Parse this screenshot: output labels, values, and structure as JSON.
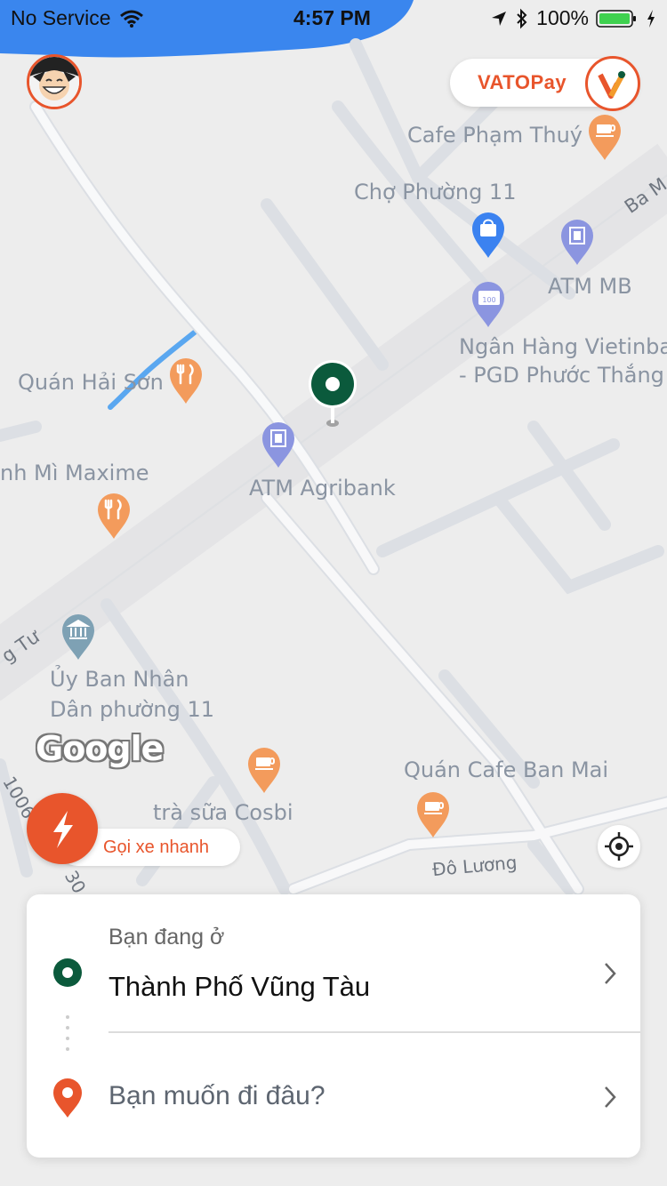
{
  "status_bar": {
    "carrier": "No Service",
    "time": "4:57 PM",
    "battery": "100%"
  },
  "vatopay": {
    "label": "VATOPay"
  },
  "map": {
    "labels": [
      "Cafe Phạm Thuý",
      "Chợ Phường 11",
      "ATM MB",
      "Ngân Hàng Vietinba",
      "- PGD Phước Thắng",
      "Quán Hải Sơn",
      "nh Mì Maxime",
      "ATM Agribank",
      "Ủy Ban Nhân",
      "Dân phường 11",
      "Quán Cafe Ban Mai",
      "trà sữa Cosbi",
      "Đô Lương",
      "Ba M",
      "g Tư",
      "1006",
      "30"
    ],
    "attribution": "Google"
  },
  "quick_ride": {
    "label": "Gọi xe nhanh"
  },
  "card": {
    "current_caption": "Bạn đang ở",
    "current_value": "Thành Phố Vũng Tàu",
    "destination_placeholder": "Bạn muốn đi đâu?"
  },
  "icons": [
    "avatar",
    "vatopay-logo-icon",
    "pickup-pin-icon",
    "lightning-icon",
    "locate-icon",
    "chevron-right-icon",
    "origin-dot-icon",
    "destination-pin-icon",
    "cafe-icon",
    "restaurant-icon",
    "shopping-icon",
    "atm-icon",
    "bank-icon",
    "government-icon"
  ],
  "colors": {
    "accent": "#e8552c",
    "pickup_green": "#0b5a3c",
    "map_bg": "#eeeeee",
    "road": "#ffffff",
    "water": "#3a86ee"
  }
}
